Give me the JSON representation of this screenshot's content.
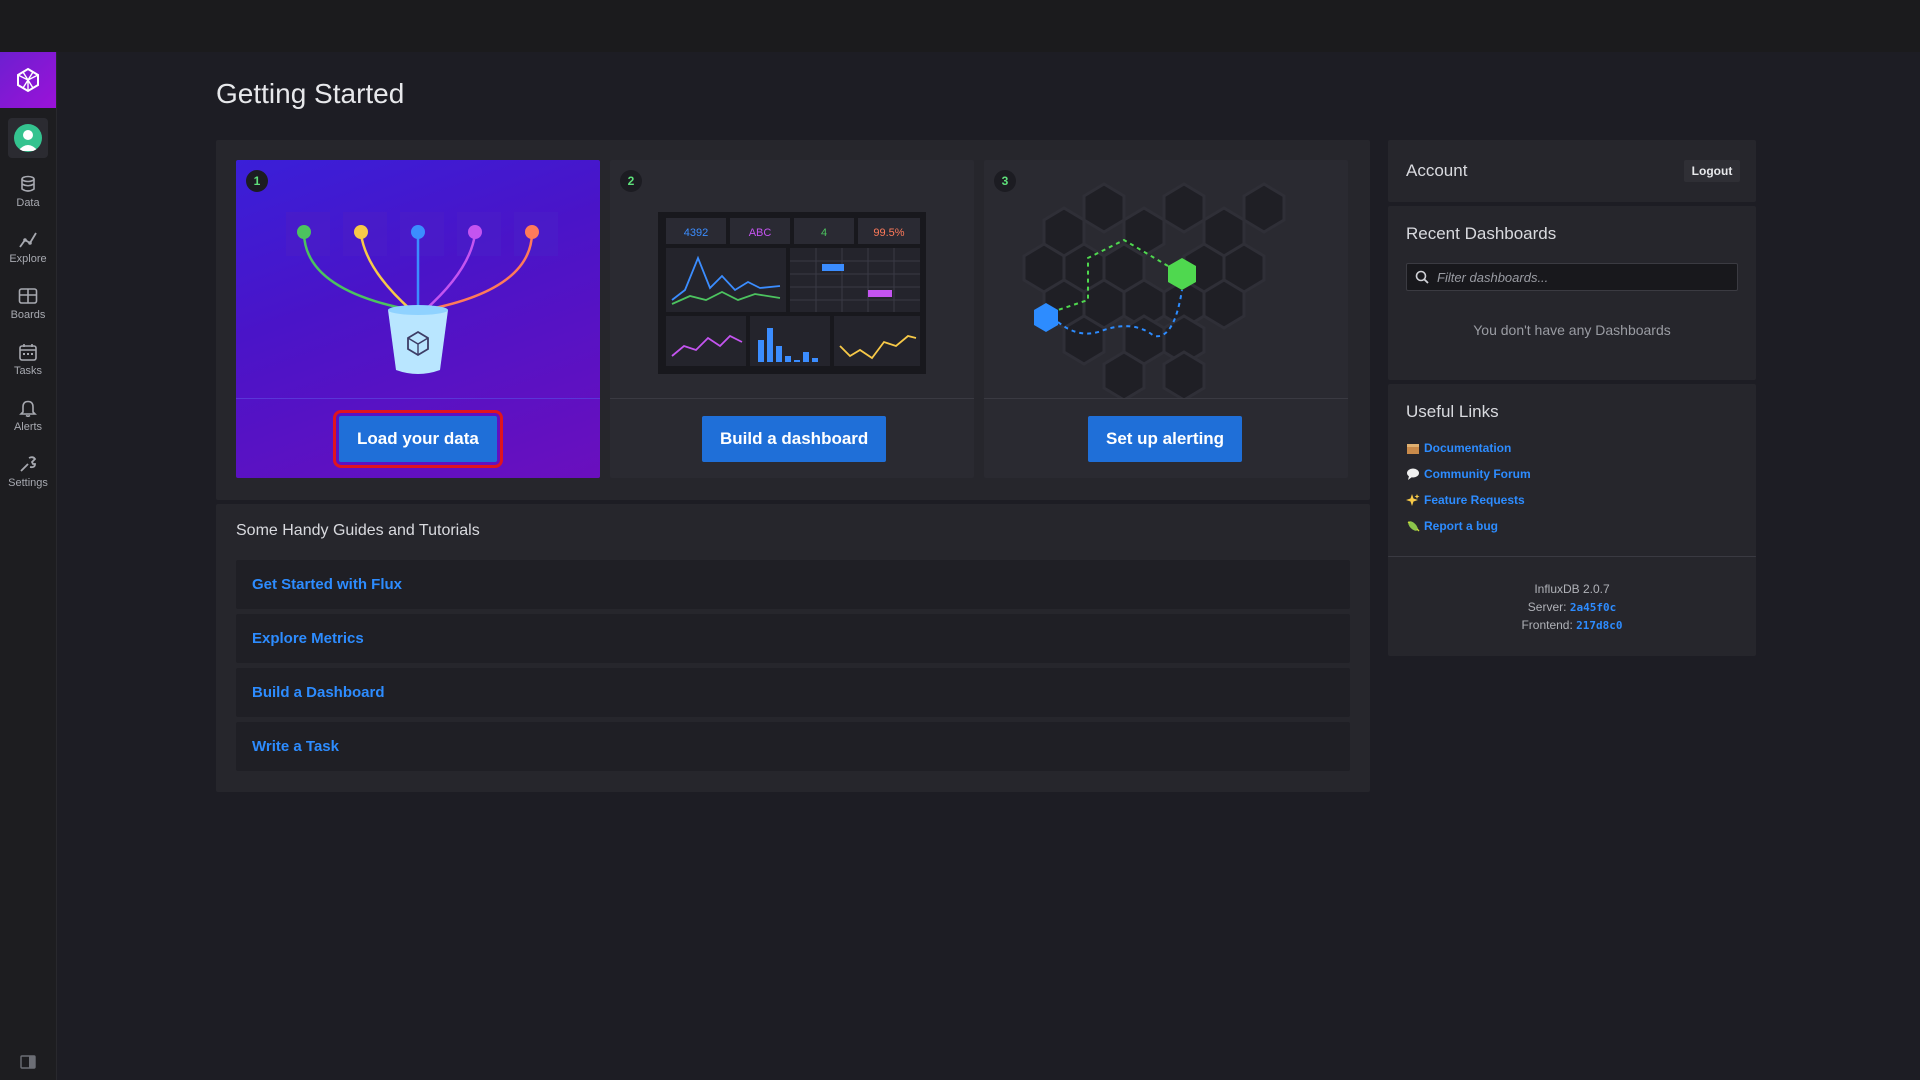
{
  "nav": {
    "items": [
      {
        "label": "Data"
      },
      {
        "label": "Explore"
      },
      {
        "label": "Boards"
      },
      {
        "label": "Tasks"
      },
      {
        "label": "Alerts"
      },
      {
        "label": "Settings"
      }
    ]
  },
  "page": {
    "title": "Getting Started"
  },
  "cards": [
    {
      "number": "1",
      "button": "Load your data"
    },
    {
      "number": "2",
      "button": "Build a dashboard",
      "stats": [
        "4392",
        "ABC",
        "4",
        "99.5%"
      ]
    },
    {
      "number": "3",
      "button": "Set up alerting"
    }
  ],
  "guides": {
    "title": "Some Handy Guides and Tutorials",
    "items": [
      {
        "label": "Get Started with Flux"
      },
      {
        "label": "Explore Metrics"
      },
      {
        "label": "Build a Dashboard"
      },
      {
        "label": "Write a Task"
      }
    ]
  },
  "account": {
    "title": "Account",
    "logout": "Logout"
  },
  "recent": {
    "title": "Recent Dashboards",
    "placeholder": "Filter dashboards...",
    "empty": "You don't have any Dashboards"
  },
  "links": {
    "title": "Useful Links",
    "items": [
      {
        "label": "Documentation"
      },
      {
        "label": "Community Forum"
      },
      {
        "label": "Feature Requests"
      },
      {
        "label": "Report a bug"
      }
    ]
  },
  "version": {
    "product": "InfluxDB 2.0.7",
    "server_label": "Server:",
    "server": "2a45f0c",
    "frontend_label": "Frontend:",
    "frontend": "217d8c0"
  },
  "colors": {
    "accent": "#1f6fd8",
    "link": "#2d8cff",
    "highlight": "#e0141e",
    "green": "#5ee07a"
  }
}
